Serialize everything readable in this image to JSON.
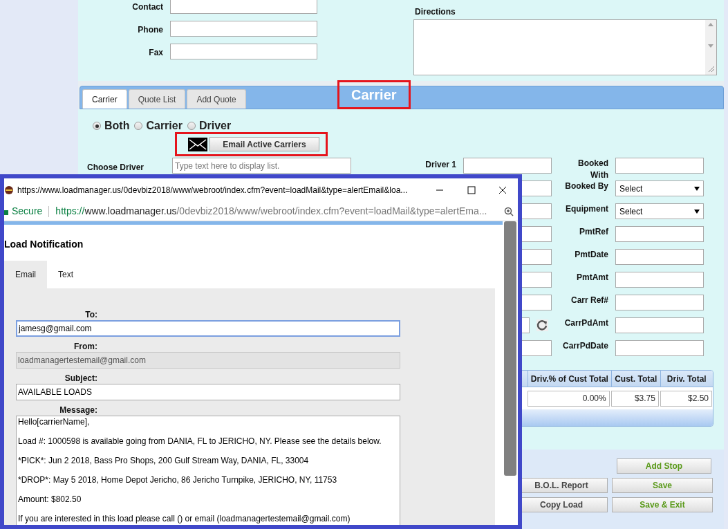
{
  "contact_fields": [
    {
      "label": "Contact"
    },
    {
      "label": "Phone"
    },
    {
      "label": "Fax"
    }
  ],
  "directions_label": "Directions",
  "tabs": [
    {
      "label": "Carrier",
      "selected": true
    },
    {
      "label": "Quote List",
      "selected": false
    },
    {
      "label": "Add Quote",
      "selected": false
    }
  ],
  "section_title": "Carrier",
  "radio_options": [
    {
      "label": "Both",
      "selected": true
    },
    {
      "label": "Carrier",
      "selected": false
    },
    {
      "label": "Driver",
      "selected": false
    }
  ],
  "email_button": "Email Active Carriers",
  "choose_driver": {
    "label": "Choose Driver",
    "placeholder": "Type text here to display list."
  },
  "driver1_label": "Driver 1",
  "right_fields": [
    {
      "label": "Booked With",
      "kind": "text"
    },
    {
      "label": "Booked By",
      "kind": "select",
      "value": "Select"
    },
    {
      "label": "Equipment",
      "kind": "select",
      "value": "Select"
    },
    {
      "label": "PmtRef",
      "kind": "text"
    },
    {
      "label": "PmtDate",
      "kind": "text"
    },
    {
      "label": "PmtAmt",
      "kind": "text"
    },
    {
      "label": "Carr Ref#",
      "kind": "text"
    },
    {
      "label": "CarrPdAmt",
      "kind": "text"
    },
    {
      "label": "CarrPdDate",
      "kind": "text"
    }
  ],
  "table": {
    "columns": [
      "Driv.% of Cust Total",
      "Cust. Total",
      "Driv. Total"
    ],
    "rows": [
      [
        "0.00%",
        "$3.75",
        "$2.50"
      ]
    ]
  },
  "buttons": [
    {
      "label": "Add Stop",
      "kind": "primary"
    },
    {
      "label": "B.O.L. Report",
      "kind": "secondary"
    },
    {
      "label": "Save",
      "kind": "primary"
    },
    {
      "label": "Copy Load",
      "kind": "secondary"
    },
    {
      "label": "Save & Exit",
      "kind": "primary"
    }
  ],
  "popup": {
    "title": "https://www.loadmanager.us/0devbiz2018/www/webroot/index.cfm?event=loadMail&type=alertEmail&loa...",
    "secure": "Secure",
    "url_scheme": "https://",
    "url_host": "www.loadmanager.us",
    "url_path": "/0devbiz2018/www/webroot/index.cfm?event=loadMail&type=alertEma...",
    "heading": "Load Notification",
    "tabs": [
      {
        "label": "Email",
        "selected": true
      },
      {
        "label": "Text",
        "selected": false
      }
    ],
    "fields": [
      {
        "label": "To:",
        "value": "jamesg@gmail.com",
        "disabled": false
      },
      {
        "label": "From:",
        "value": "loadmanagertestemail@gmail.com",
        "disabled": true
      },
      {
        "label": "Subject:",
        "value": "AVAILABLE LOADS",
        "disabled": false
      }
    ],
    "message_label": "Message:",
    "message_lines": [
      "Hello[carrierName],",
      "Load #: 1000598 is available going from DANIA, FL to JERICHO, NY. Please see the details below.",
      "*PICK*: Jun 2 2018, Bass Pro Shops, 200 Gulf Stream Way, DANIA, FL, 33004",
      "*DROP*: May 5 2018, Home Depot Jericho, 86 Jericho Turnpike, JERICHO, NY, 11753",
      "Amount: $802.50",
      "If you are interested in this load please call () or email (loadmanagertestemail@gmail.com)"
    ]
  }
}
